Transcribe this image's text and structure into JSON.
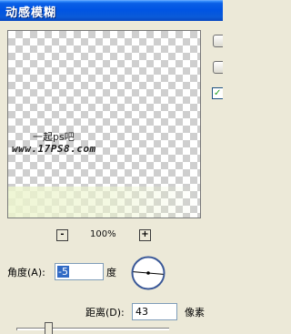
{
  "title": "动感模糊",
  "preview": {
    "watermark_line1": "一起ps吧",
    "watermark_line2": "www.17PS8.com",
    "blur_glow_color": "#ecf4cd"
  },
  "side": {
    "checkbox_mark": "✓"
  },
  "zoom": {
    "minus_label": "-",
    "level": "100%",
    "plus_label": "+"
  },
  "angle": {
    "label": "角度(A):",
    "value": "-5",
    "unit": "度"
  },
  "distance": {
    "label": "距离(D):",
    "value": "43",
    "unit": "像素"
  },
  "colors": {
    "titlebar": "#0054e3",
    "dialog_bg": "#ece9d8",
    "selection": "#316ac5",
    "dial_ring": "#3b5998"
  }
}
